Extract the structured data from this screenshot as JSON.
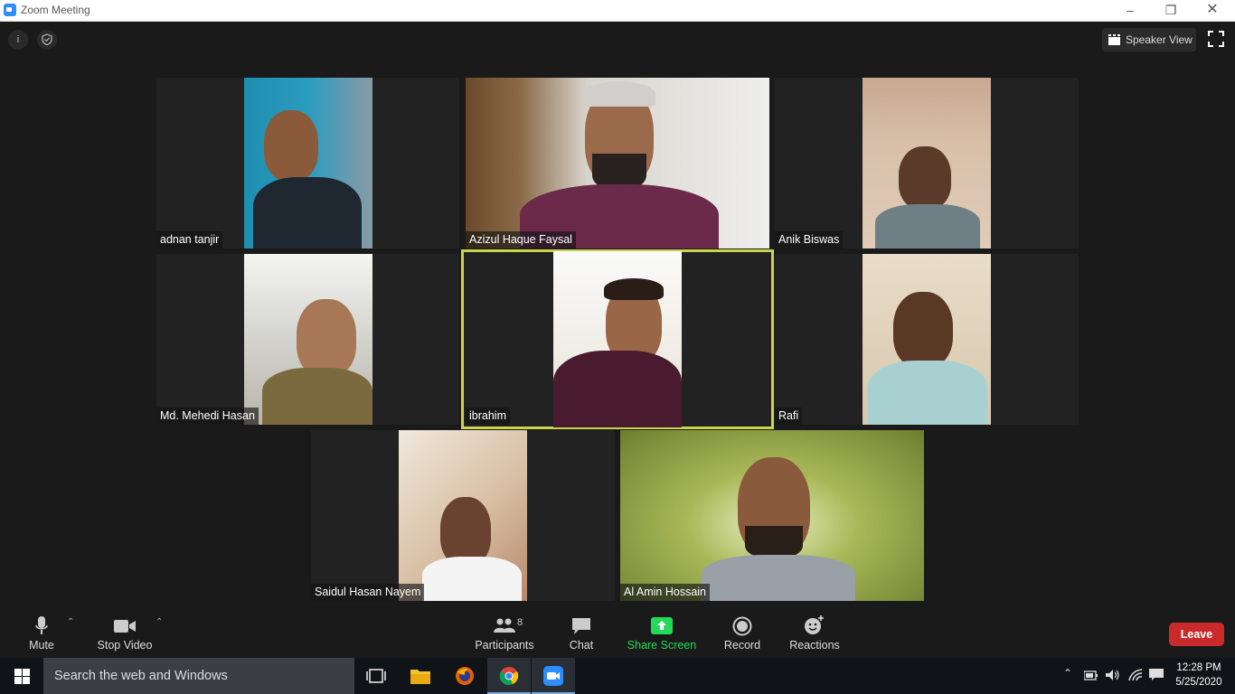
{
  "window": {
    "title": "Zoom Meeting",
    "controls": [
      "minimize",
      "restore",
      "close"
    ]
  },
  "top_bar": {
    "info_icon": "info-icon",
    "security_icon": "shield-icon",
    "view_label": "Speaker View"
  },
  "participants": [
    {
      "name": "adnan tanjir"
    },
    {
      "name": "Azizul Haque Faysal"
    },
    {
      "name": "Anik Biswas"
    },
    {
      "name": "Md. Mehedi Hasan"
    },
    {
      "name": "ibrahim",
      "active_speaker": true
    },
    {
      "name": "Rafi"
    },
    {
      "name": "Saidul Hasan Nayem"
    },
    {
      "name": "Al Amin Hossain"
    }
  ],
  "toolbar": {
    "mute": "Mute",
    "stop_video": "Stop Video",
    "participants": "Participants",
    "participants_count": "8",
    "chat": "Chat",
    "share_screen": "Share Screen",
    "record": "Record",
    "reactions": "Reactions",
    "leave": "Leave"
  },
  "taskbar": {
    "search_placeholder": "Search the web and Windows",
    "apps": [
      "task-view-icon",
      "file-explorer-icon",
      "firefox-icon",
      "chrome-icon",
      "zoom-icon"
    ],
    "time": "12:28 PM",
    "date": "5/25/2020"
  },
  "colors": {
    "leave": "#c92b2b",
    "share_screen": "#23d959",
    "active_border": "#c8d64b",
    "zoom_blue": "#2d8cff"
  }
}
